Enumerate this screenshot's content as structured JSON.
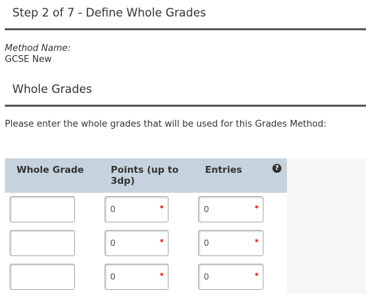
{
  "header": {
    "step_title": "Step 2 of 7 - Define Whole Grades"
  },
  "method": {
    "label": "Method Name:",
    "value": "GCSE New"
  },
  "section": {
    "title": "Whole Grades"
  },
  "instructions": "Please enter the whole grades that will be used for this Grades Method:",
  "grid": {
    "columns": [
      "Whole Grade",
      "Points (up to 3dp)",
      "Entries"
    ],
    "help_icon": "?",
    "required_marker": "*",
    "rows": [
      {
        "whole_grade": "",
        "points": "0",
        "entries": "0"
      },
      {
        "whole_grade": "",
        "points": "0",
        "entries": "0"
      },
      {
        "whole_grade": "",
        "points": "0",
        "entries": "0"
      }
    ]
  },
  "colors": {
    "header_rule": "#595959",
    "grid_header_bg": "#c6d3de",
    "grid_side_bg": "#f6f6f6",
    "required_red": "#d40000"
  },
  "icons": {
    "help": "question-circle-icon",
    "required": "asterisk-icon"
  }
}
